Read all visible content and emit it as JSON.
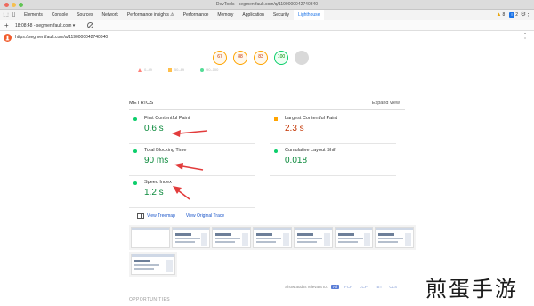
{
  "window": {
    "title": "DevTools - segmentfault.com/q/1190000042740840"
  },
  "tabs": [
    {
      "label": "Elements",
      "active": false
    },
    {
      "label": "Console",
      "active": false
    },
    {
      "label": "Sources",
      "active": false
    },
    {
      "label": "Network",
      "active": false
    },
    {
      "label": "Performance insights ⚠",
      "active": false
    },
    {
      "label": "Performance",
      "active": false
    },
    {
      "label": "Memory",
      "active": false
    },
    {
      "label": "Application",
      "active": false
    },
    {
      "label": "Security",
      "active": false
    },
    {
      "label": "Lighthouse",
      "active": true
    }
  ],
  "status": {
    "warnings": "8",
    "issues": "2"
  },
  "lighthouse_bar": {
    "report_select": "18:08:48 - segmentfault.com ▾"
  },
  "url": "https://segmentfault.com/a/1190000042740840",
  "scores": [
    {
      "value": "67",
      "rating": "average"
    },
    {
      "value": "88",
      "rating": "average"
    },
    {
      "value": "83",
      "rating": "average"
    },
    {
      "value": "100",
      "rating": "good"
    },
    {
      "value": "",
      "rating": "pwa"
    }
  ],
  "legend": [
    "0–49",
    "50–89",
    "90–100"
  ],
  "metrics_section": {
    "title": "METRICS",
    "expand_label": "Expand view",
    "items": [
      {
        "label": "First Contentful Paint",
        "value": "0.6 s",
        "rating": "good"
      },
      {
        "label": "Largest Contentful Paint",
        "value": "2.3 s",
        "rating": "average"
      },
      {
        "label": "Total Blocking Time",
        "value": "90 ms",
        "rating": "good"
      },
      {
        "label": "Cumulative Layout Shift",
        "value": "0.018",
        "rating": "good"
      },
      {
        "label": "Speed Index",
        "value": "1.2 s",
        "rating": "good"
      }
    ]
  },
  "links": {
    "treemap": "View Treemap",
    "trace": "View Original Trace"
  },
  "audit_filter": {
    "label": "Show audits relevant to:",
    "chips": [
      {
        "label": "All",
        "active": true
      },
      {
        "label": "FCP",
        "active": false
      },
      {
        "label": "LCP",
        "active": false
      },
      {
        "label": "TBT",
        "active": false
      },
      {
        "label": "CLS",
        "active": false
      }
    ]
  },
  "opportunities_title": "OPPORTUNITIES",
  "watermark": "煎蛋手游",
  "colors": {
    "good": "#0cce6b",
    "average": "#ffa400",
    "arrow": "#e23c3c",
    "accent": "#1a73e8"
  }
}
